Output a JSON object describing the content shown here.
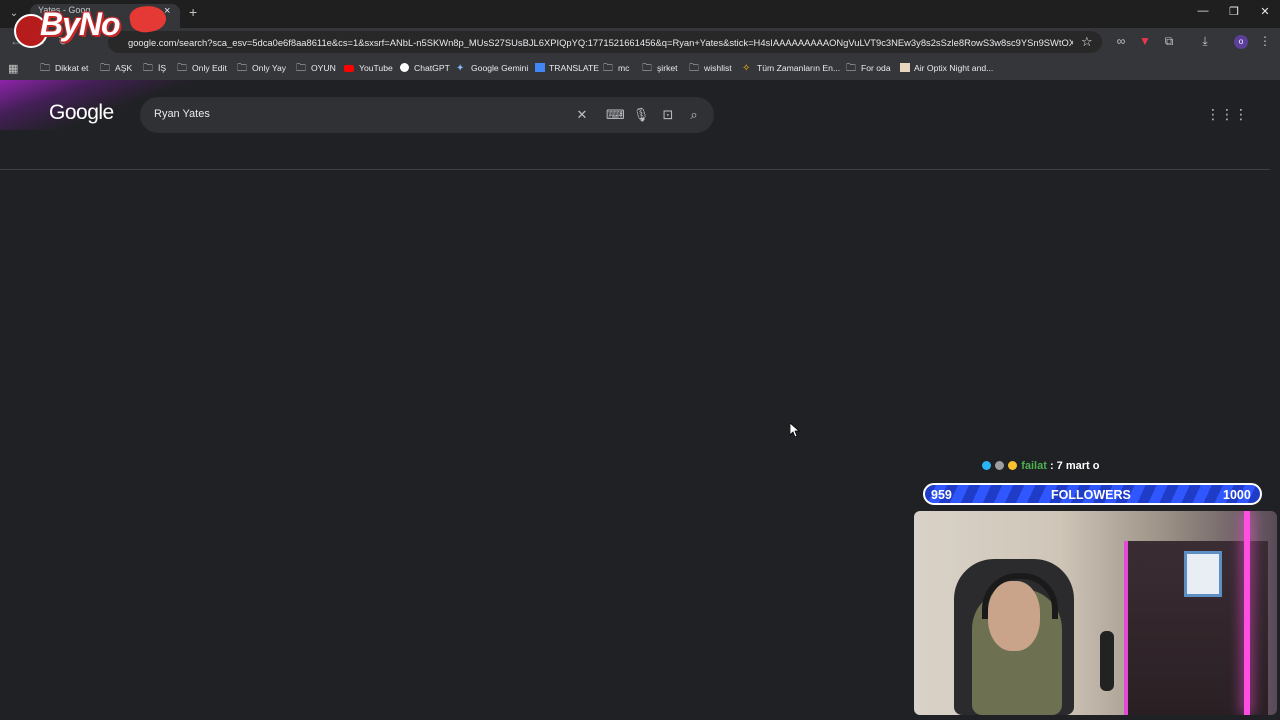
{
  "tab": {
    "title": "Yates - Goog",
    "close": "×",
    "new_tab": "+"
  },
  "stream_logo": {
    "text": "ByNo"
  },
  "toolbar": {
    "url": "google.com/search?sca_esv=5dca0e6f8aa8611e&cs=1&sxsrf=ANbL-n5SKWn8p_MUsS27SUsBJL6XPIQpYQ:1771521661456&q=Ryan+Yates&stick=H4sIAAAAAAAAAONgVuLVT9c3NEw3y8s2sSzle8RowS3w8sc9YSn9SWtOXmPU5O...",
    "profile_initial": "o"
  },
  "bookmarks": [
    {
      "label": "Dikkat et",
      "icon": "folder-icon"
    },
    {
      "label": "AŞK",
      "icon": "folder-icon"
    },
    {
      "label": "İŞ",
      "icon": "folder-icon"
    },
    {
      "label": "Only Edit",
      "icon": "folder-icon"
    },
    {
      "label": "Only Yay",
      "icon": "folder-icon"
    },
    {
      "label": "OYUN",
      "icon": "folder-icon"
    },
    {
      "label": "YouTube",
      "icon": "youtube-icon"
    },
    {
      "label": "ChatGPT",
      "icon": "chatgpt-icon"
    },
    {
      "label": "Google Gemini",
      "icon": "gemini-icon"
    },
    {
      "label": "TRANSLATE",
      "icon": "translate-icon"
    },
    {
      "label": "mc",
      "icon": "folder-icon"
    },
    {
      "label": "şirket",
      "icon": "folder-icon"
    },
    {
      "label": "wishlist",
      "icon": "folder-icon"
    },
    {
      "label": "Tüm Zamanların En...",
      "icon": "star-icon"
    },
    {
      "label": "For oda",
      "icon": "folder-icon"
    },
    {
      "label": "Air Optix Night and...",
      "icon": "site-icon"
    }
  ],
  "page": {
    "logo": "Google",
    "search_query": "Ryan Yates"
  },
  "overlay": {
    "chat_user": "failat",
    "chat_message": ": 7 mart o",
    "followers_current": "959",
    "followers_label": "FOLLOWERS",
    "followers_goal": "1000"
  },
  "colors": {
    "background": "#202124",
    "search_box": "#303134",
    "follow_bar": "#2f56ff",
    "chat_user": "#4caf50"
  }
}
